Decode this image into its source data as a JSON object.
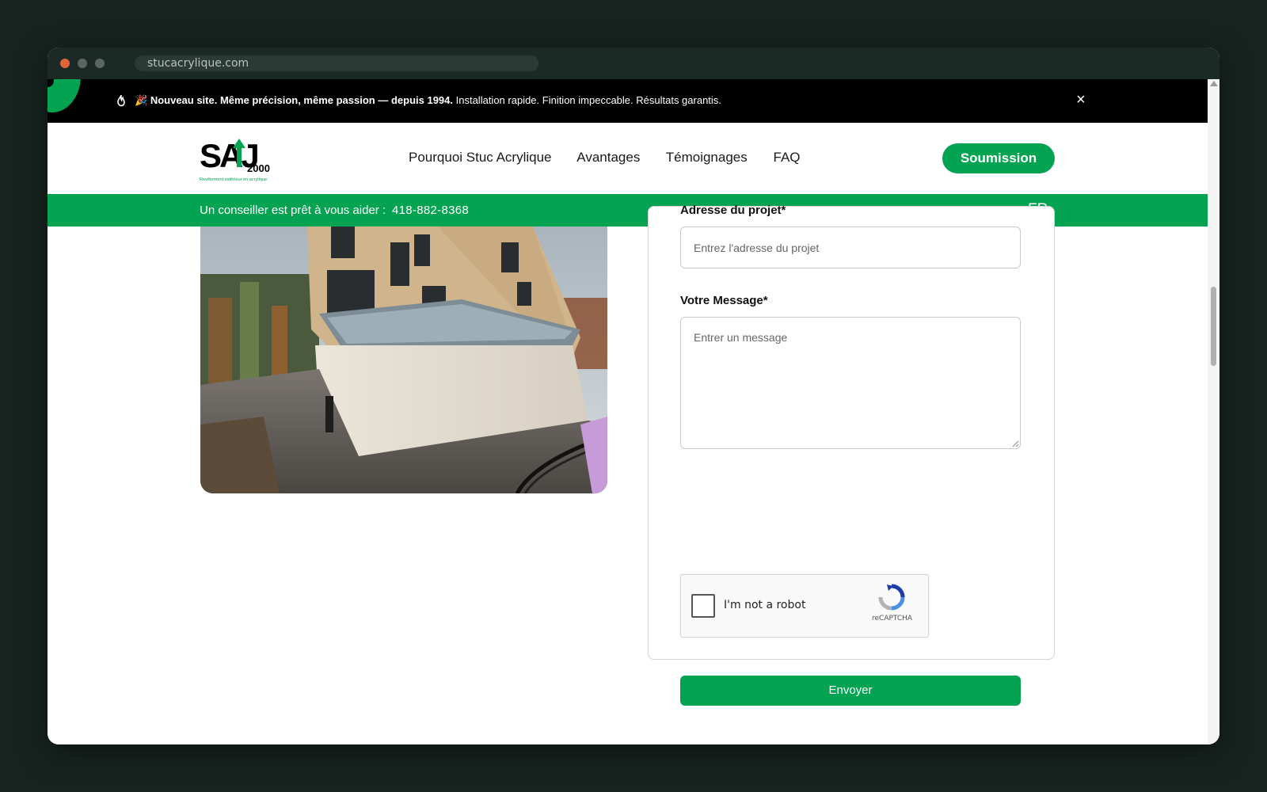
{
  "browser": {
    "url": "stucacrylique.com"
  },
  "announcement": {
    "emoji": "🎉",
    "bold_text": "Nouveau site. Même précision, même passion — depuis 1994.",
    "text": " Installation rapide. Finition impeccable. Résultats garantis.",
    "close_symbol": "×"
  },
  "header": {
    "logo_text": "SAJ",
    "logo_year": "2000",
    "logo_tagline": "Revêtement extérieur en acrylique",
    "nav": [
      "Pourquoi Stuc Acrylique",
      "Avantages",
      "Témoignages",
      "FAQ"
    ],
    "cta": "Soumission"
  },
  "greenbar": {
    "label": "Un conseiller est prêt à vous aider :",
    "phone": "418-882-8368",
    "lang": "FR"
  },
  "form": {
    "address_label": "Adresse du projet*",
    "address_placeholder": "Entrez l'adresse du projet",
    "message_label": "Votre Message*",
    "message_placeholder": "Entrer un message",
    "captcha_text": "I'm not a robot",
    "captcha_brand": "reCAPTCHA",
    "submit": "Envoyer"
  },
  "colors": {
    "brand_green": "#04a352",
    "announcement_bg": "#000000"
  }
}
